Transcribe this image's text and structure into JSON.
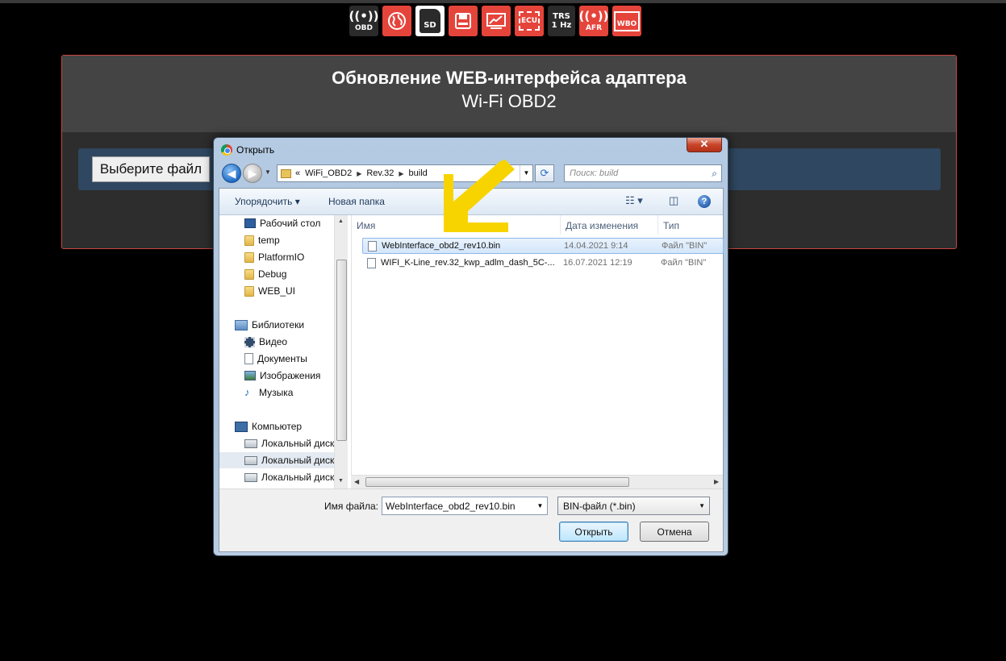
{
  "toolbar": {
    "icons": [
      {
        "name": "obd-icon",
        "label": "OBD",
        "symbol": "((•))"
      },
      {
        "name": "globe-icon",
        "label": "",
        "symbol": ""
      },
      {
        "name": "sd-card-icon",
        "label": "SD",
        "symbol": ""
      },
      {
        "name": "floppy-icon",
        "label": "",
        "symbol": ""
      },
      {
        "name": "chart-icon",
        "label": "",
        "symbol": ""
      },
      {
        "name": "ecu-icon",
        "label": "ECU",
        "symbol": ""
      },
      {
        "name": "trs-icon",
        "label": "TRS",
        "label2": "1 Hz"
      },
      {
        "name": "afr-icon",
        "label": "AFR",
        "symbol": "((•))"
      },
      {
        "name": "wbo-icon",
        "label": "WBO",
        "symbol": ""
      }
    ],
    "colors": {
      "dark": "#2b2b2b",
      "red": "#e5443b"
    }
  },
  "panel": {
    "title": "Обновление WEB-интерфейса адаптера",
    "subtitle": "Wi-Fi OBD2",
    "choose_file_label": "Выберите файл"
  },
  "dialog": {
    "title": "Открыть",
    "close_symbol": "✕",
    "address": {
      "prefix": "«",
      "crumbs": [
        "WiFi_OBD2",
        "Rev.32",
        "build"
      ]
    },
    "search_placeholder": "Поиск: build",
    "commands": {
      "organize": "Упорядочить ▾",
      "new_folder": "Новая папка"
    },
    "nav": {
      "favorites": [
        "Рабочий стол",
        "temp",
        "PlatformIO",
        "Debug",
        "WEB_UI"
      ],
      "libraries_label": "Библиотеки",
      "libraries": [
        "Видео",
        "Документы",
        "Изображения",
        "Музыка"
      ],
      "computer_label": "Компьютер",
      "drives": [
        "Локальный диск",
        "Локальный диск",
        "Локальный диск"
      ]
    },
    "columns": {
      "name": "Имя",
      "date": "Дата изменения",
      "type": "Тип"
    },
    "files": [
      {
        "name": "WebInterface_obd2_rev10.bin",
        "date": "14.04.2021 9:14",
        "type": "Файл \"BIN\"",
        "selected": true
      },
      {
        "name": "WIFI_K-Line_rev.32_kwp_adlm_dash_5C-...",
        "date": "16.07.2021 12:19",
        "type": "Файл \"BIN\"",
        "selected": false
      }
    ],
    "filename_label": "Имя файла:",
    "filename_value": "WebInterface_obd2_rev10.bin",
    "filter_value": "BIN-файл (*.bin)",
    "open_label": "Открыть",
    "cancel_label": "Отмена"
  },
  "annotation": {
    "arrow_color": "#f7d400"
  }
}
